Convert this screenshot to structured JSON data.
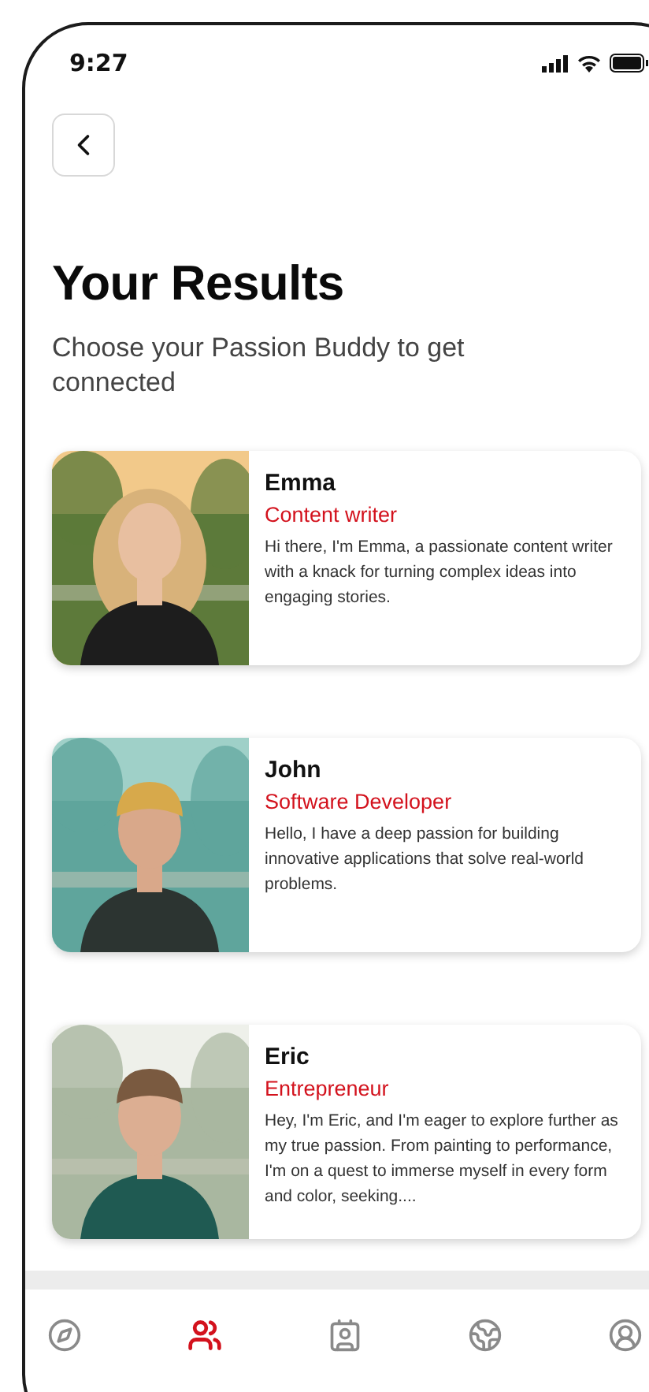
{
  "status_bar": {
    "time": "9:27"
  },
  "title": "Your Results",
  "subtitle": "Choose your Passion Buddy to get connected",
  "profiles": [
    {
      "name": "Emma",
      "role": "Content writer",
      "bio": "Hi there, I'm Emma, a passionate content writer with a knack for turning complex ideas into engaging stories."
    },
    {
      "name": "John",
      "role": "Software Developer",
      "bio": "Hello, I have a deep passion for building innovative applications that solve real-world problems."
    },
    {
      "name": "Eric",
      "role": "Entrepreneur",
      "bio": "Hey, I'm Eric, and I'm eager to explore further as my true passion. From painting to performance, I'm on a quest to immerse myself in every form and color, seeking...."
    }
  ],
  "nav": [
    {
      "kind": "explore",
      "selected": false
    },
    {
      "kind": "community",
      "selected": true
    },
    {
      "kind": "friends",
      "selected": false
    },
    {
      "kind": "globe",
      "selected": false
    },
    {
      "kind": "profile",
      "selected": false
    }
  ]
}
